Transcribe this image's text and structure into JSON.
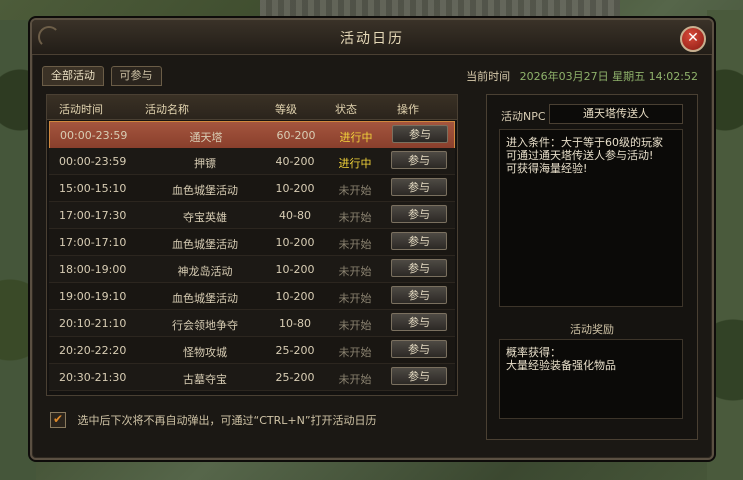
{
  "window": {
    "title": "活动日历",
    "close_symbol": "✕"
  },
  "tabs": [
    {
      "label": "全部活动",
      "active": true
    },
    {
      "label": "可参与",
      "active": false
    }
  ],
  "time": {
    "label": "当前时间",
    "value": "2026年03月27日 星期五 14:02:52"
  },
  "table": {
    "headers": [
      "活动时间",
      "活动名称",
      "等级",
      "状态",
      "操作"
    ],
    "rows": [
      {
        "time": "00:00-23:59",
        "name": "通天塔",
        "level": "60-200",
        "status": "进行中",
        "status_type": "active",
        "action": "参与",
        "selected": true
      },
      {
        "time": "00:00-23:59",
        "name": "押镖",
        "level": "40-200",
        "status": "进行中",
        "status_type": "active",
        "action": "参与",
        "selected": false
      },
      {
        "time": "15:00-15:10",
        "name": "血色城堡活动",
        "level": "10-200",
        "status": "未开始",
        "status_type": "wait",
        "action": "参与",
        "selected": false
      },
      {
        "time": "17:00-17:30",
        "name": "夺宝英雄",
        "level": "40-80",
        "status": "未开始",
        "status_type": "wait",
        "action": "参与",
        "selected": false
      },
      {
        "time": "17:00-17:10",
        "name": "血色城堡活动",
        "level": "10-200",
        "status": "未开始",
        "status_type": "wait",
        "action": "参与",
        "selected": false
      },
      {
        "time": "18:00-19:00",
        "name": "神龙岛活动",
        "level": "10-200",
        "status": "未开始",
        "status_type": "wait",
        "action": "参与",
        "selected": false
      },
      {
        "time": "19:00-19:10",
        "name": "血色城堡活动",
        "level": "10-200",
        "status": "未开始",
        "status_type": "wait",
        "action": "参与",
        "selected": false
      },
      {
        "time": "20:10-21:10",
        "name": "行会领地争夺",
        "level": "10-80",
        "status": "未开始",
        "status_type": "wait",
        "action": "参与",
        "selected": false
      },
      {
        "time": "20:20-22:20",
        "name": "怪物攻城",
        "level": "25-200",
        "status": "未开始",
        "status_type": "wait",
        "action": "参与",
        "selected": false
      },
      {
        "time": "20:30-21:30",
        "name": "古墓夺宝",
        "level": "25-200",
        "status": "未开始",
        "status_type": "wait",
        "action": "参与",
        "selected": false
      }
    ]
  },
  "footer": {
    "checked": true,
    "check_symbol": "✔",
    "text": "选中后下次将不再自动弹出，可通过“CTRL+N”打开活动日历"
  },
  "detail": {
    "npc_label": "活动NPC",
    "npc_name": "通天塔传送人",
    "description_lines": [
      "进入条件：大于等于60级的玩家",
      "可通过通天塔传送人参与活动!",
      "可获得海量经验!"
    ],
    "reward_title": "活动奖励",
    "reward_lines": [
      "概率获得：",
      "大量经验装备强化物品"
    ]
  },
  "colors": {
    "active_status": "#f2d33a",
    "wait_status": "#8a8270",
    "time_value": "#8fb26b",
    "selected_row": "#a4553e"
  }
}
